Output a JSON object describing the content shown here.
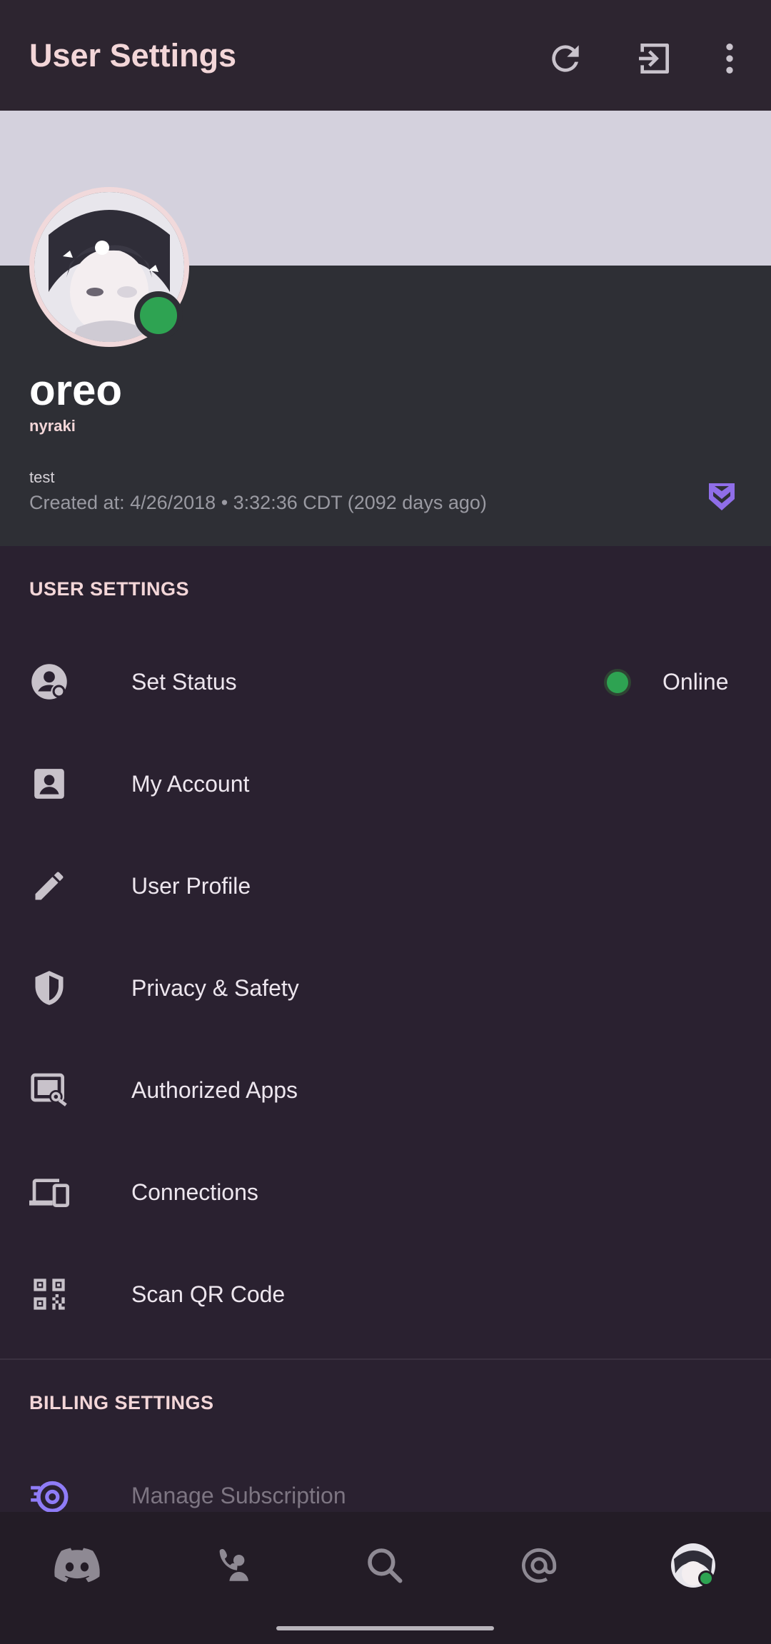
{
  "header": {
    "title": "User Settings",
    "icons": [
      "refresh-icon",
      "logout-icon",
      "more-vert-icon"
    ]
  },
  "profile": {
    "display_name": "oreo",
    "username": "nyraki",
    "bio": "test",
    "created": "Created at: 4/26/2018 • 3:32:36 CDT (2092 days ago)",
    "status_color": "#2ea352",
    "badge_icon": "hypesquad-badge-icon"
  },
  "user_settings": {
    "label": "USER SETTINGS",
    "items": [
      {
        "label": "Set Status",
        "icon": "status-user-icon",
        "value": "Online"
      },
      {
        "label": "My Account",
        "icon": "account-card-icon"
      },
      {
        "label": "User Profile",
        "icon": "pencil-icon"
      },
      {
        "label": "Privacy & Safety",
        "icon": "shield-icon"
      },
      {
        "label": "Authorized Apps",
        "icon": "authorized-apps-icon"
      },
      {
        "label": "Connections",
        "icon": "devices-icon"
      },
      {
        "label": "Scan QR Code",
        "icon": "qr-code-icon"
      }
    ]
  },
  "billing_settings": {
    "label": "BILLING SETTINGS",
    "items": [
      {
        "label": "Manage Subscription",
        "icon": "nitro-icon"
      }
    ]
  },
  "bottom_nav": [
    "discord-home-icon",
    "friends-icon",
    "search-icon",
    "mentions-icon",
    "profile-avatar"
  ],
  "colors": {
    "accent_pink": "#f3d6d8",
    "online_green": "#2ea352",
    "nitro_purple": "#8f7cf7",
    "background": "#2a2130"
  }
}
